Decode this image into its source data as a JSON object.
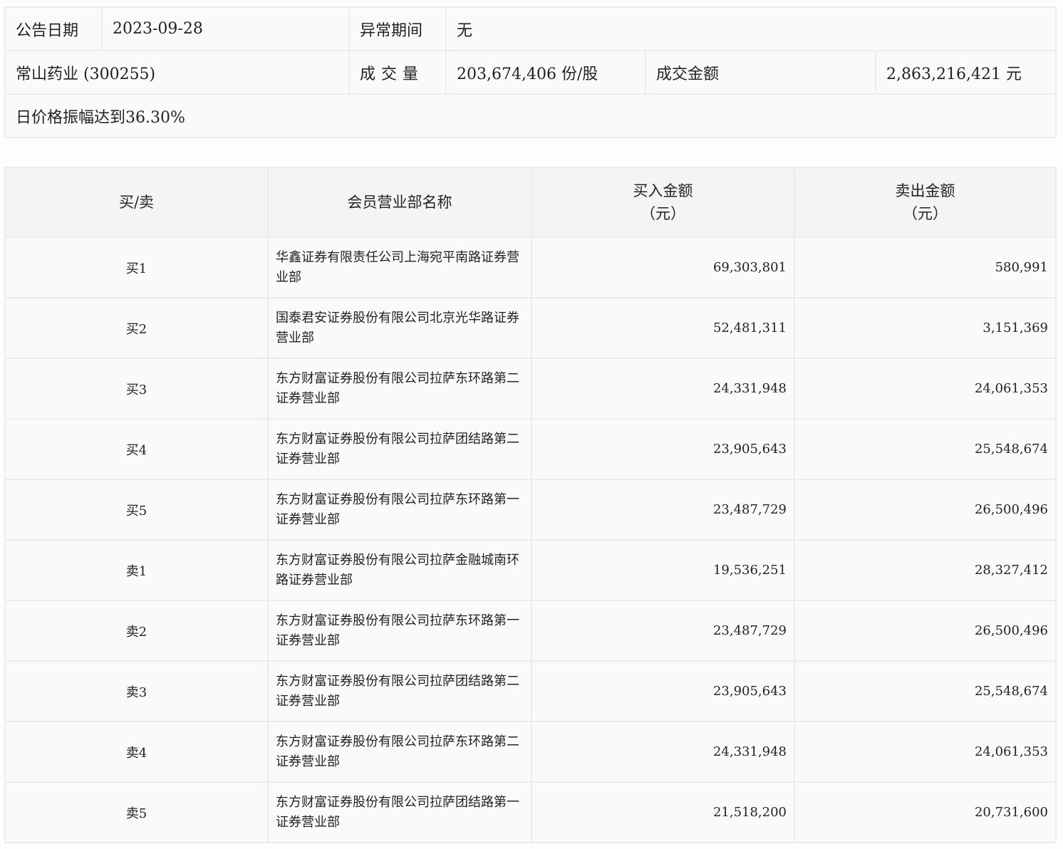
{
  "info": {
    "date_label": "公告日期",
    "date": "2023-09-28",
    "period_label": "异常期间",
    "period": "无",
    "stock": "常山药业 (300255)",
    "volume_label": "成交量",
    "volume": "203,674,406 份/股",
    "amount_label": "成交金额",
    "amount": "2,863,216,421 元",
    "reason": "日价格振幅达到36.30%"
  },
  "table": {
    "headers": [
      "买/卖",
      "会员营业部名称",
      "买入金额",
      "（元）",
      "卖出金额",
      "（元）"
    ],
    "rows": [
      {
        "side": "买1",
        "name": "华鑫证券有限责任公司上海宛平南路证券营业部",
        "buy": "69,303,801",
        "sell": "580,991"
      },
      {
        "side": "买2",
        "name": "国泰君安证券股份有限公司北京光华路证券营业部",
        "buy": "52,481,311",
        "sell": "3,151,369"
      },
      {
        "side": "买3",
        "name": "东方财富证券股份有限公司拉萨东环路第二证券营业部",
        "buy": "24,331,948",
        "sell": "24,061,353"
      },
      {
        "side": "买4",
        "name": "东方财富证券股份有限公司拉萨团结路第二证券营业部",
        "buy": "23,905,643",
        "sell": "25,548,674"
      },
      {
        "side": "买5",
        "name": "东方财富证券股份有限公司拉萨东环路第一证券营业部",
        "buy": "23,487,729",
        "sell": "26,500,496"
      },
      {
        "side": "卖1",
        "name": "东方财富证券股份有限公司拉萨金融城南环路证券营业部",
        "buy": "19,536,251",
        "sell": "28,327,412"
      },
      {
        "side": "卖2",
        "name": "东方财富证券股份有限公司拉萨东环路第一证券营业部",
        "buy": "23,487,729",
        "sell": "26,500,496"
      },
      {
        "side": "卖3",
        "name": "东方财富证券股份有限公司拉萨团结路第二证券营业部",
        "buy": "23,905,643",
        "sell": "25,548,674"
      },
      {
        "side": "卖4",
        "name": "东方财富证券股份有限公司拉萨东环路第二证券营业部",
        "buy": "24,331,948",
        "sell": "24,061,353"
      },
      {
        "side": "卖5",
        "name": "东方财富证券股份有限公司拉萨团结路第一证券营业部",
        "buy": "21,518,200",
        "sell": "20,731,600"
      }
    ]
  }
}
